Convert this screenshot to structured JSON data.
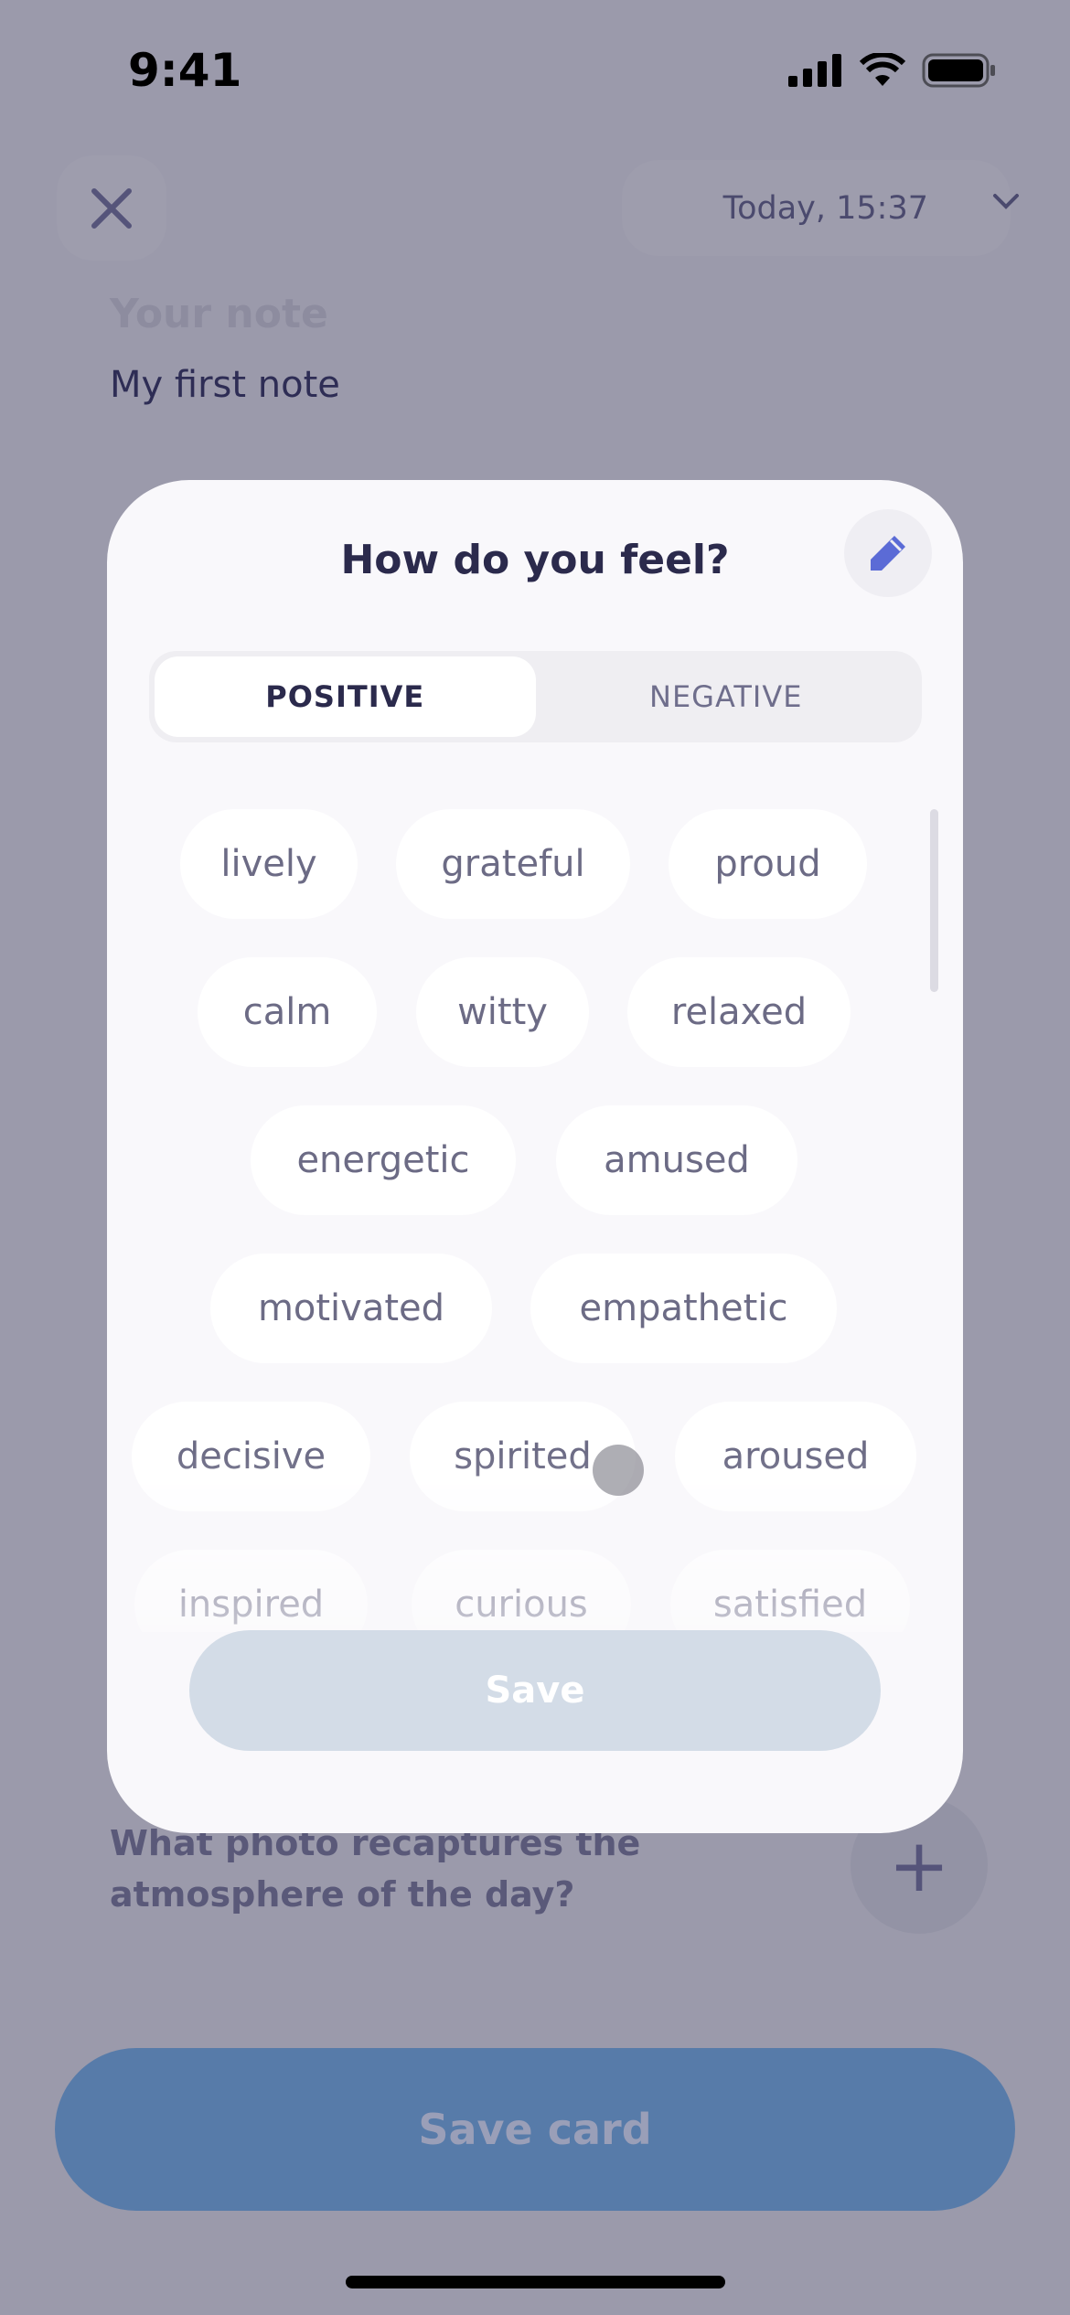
{
  "status_bar": {
    "time": "9:41"
  },
  "header": {
    "date_label": "Today, 15:37"
  },
  "note": {
    "label": "Your note",
    "value": "My first note"
  },
  "photo_section": {
    "question": "What photo recaptures the atmosphere of the day?"
  },
  "save_card_label": "Save card",
  "modal": {
    "title": "How do you feel?",
    "tabs": [
      {
        "label": "POSITIVE",
        "selected": true
      },
      {
        "label": "NEGATIVE",
        "selected": false
      }
    ],
    "chips": [
      "lively",
      "grateful",
      "proud",
      "calm",
      "witty",
      "relaxed",
      "energetic",
      "amused",
      "motivated",
      "empathetic",
      "decisive",
      "spirited",
      "aroused",
      "inspired",
      "curious",
      "satisfied"
    ],
    "save_label": "Save"
  },
  "colors": {
    "accent": "#5b6bd6",
    "save_card": "#577ba9",
    "save_disabled": "#d3dce7"
  }
}
